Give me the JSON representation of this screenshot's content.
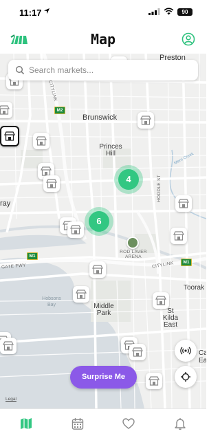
{
  "status_bar": {
    "time": "11:17",
    "battery": "90"
  },
  "header": {
    "title": "Map"
  },
  "search": {
    "placeholder": "Search markets..."
  },
  "map": {
    "suburbs": [
      "Preston",
      "Brunswick",
      "Princes Hill",
      "Middle Park",
      "St Kilda East",
      "Toorak",
      "Ca",
      "Ea"
    ],
    "small_labels": [
      "CITYLINK",
      "HODDLE ST",
      "ROD LAVER ARENA",
      "CITYLINK",
      "GATE FWY",
      "Merri Creek",
      "Hobsons Bay",
      "ray"
    ],
    "route_shields": [
      "M2",
      "M1",
      "M1"
    ],
    "clusters": [
      {
        "count": "4"
      },
      {
        "count": "6"
      }
    ]
  },
  "actions": {
    "surprise_label": "Surprise Me",
    "legal_label": "Legal"
  },
  "tabs": [
    {
      "name": "map",
      "active": true
    },
    {
      "name": "calendar",
      "active": false
    },
    {
      "name": "favorites",
      "active": false
    },
    {
      "name": "notifications",
      "active": false
    }
  ],
  "colors": {
    "accent": "#32c782",
    "purple": "#8b59e8",
    "inactive": "#8a8a8a"
  }
}
